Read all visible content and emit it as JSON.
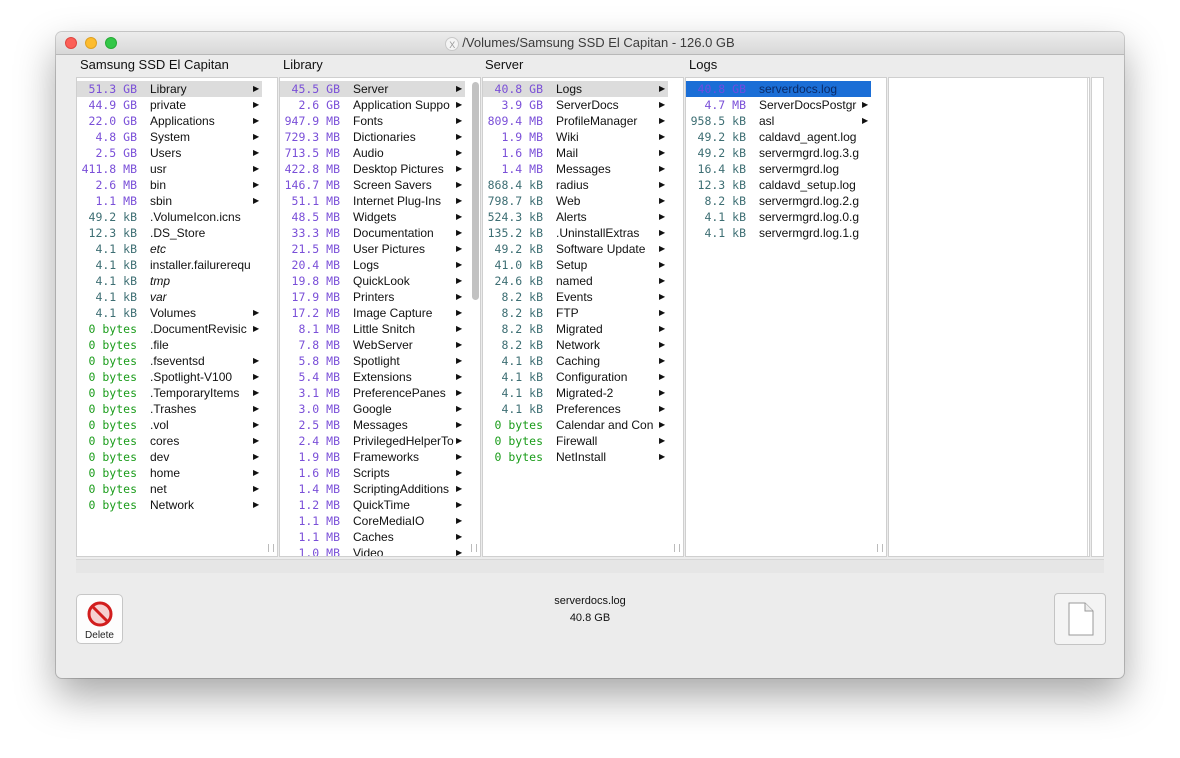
{
  "window": {
    "title": "/Volumes/Samsung SSD El Capitan  - 126.0 GB",
    "title_icon_glyph": "X"
  },
  "columns": [
    {
      "header": "Samsung SSD El Capitan",
      "selected_index": 0,
      "rows": [
        {
          "size": "51.3 GB",
          "name": "Library",
          "unit": "gb",
          "arrow": true
        },
        {
          "size": "44.9 GB",
          "name": "private",
          "unit": "gb",
          "arrow": true
        },
        {
          "size": "22.0 GB",
          "name": "Applications",
          "unit": "gb",
          "arrow": true
        },
        {
          "size": "4.8 GB",
          "name": "System",
          "unit": "gb",
          "arrow": true
        },
        {
          "size": "2.5 GB",
          "name": "Users",
          "unit": "gb",
          "arrow": true
        },
        {
          "size": "411.8 MB",
          "name": "usr",
          "unit": "mb",
          "arrow": true
        },
        {
          "size": "2.6 MB",
          "name": "bin",
          "unit": "mb",
          "arrow": true
        },
        {
          "size": "1.1 MB",
          "name": "sbin",
          "unit": "mb",
          "arrow": true
        },
        {
          "size": "49.2 kB",
          "name": ".VolumeIcon.icns",
          "unit": "kb",
          "arrow": false
        },
        {
          "size": "12.3 kB",
          "name": ".DS_Store",
          "unit": "kb",
          "arrow": false
        },
        {
          "size": "4.1 kB",
          "name": "etc",
          "unit": "kb",
          "arrow": false,
          "italic": true
        },
        {
          "size": "4.1 kB",
          "name": "installer.failurerequ",
          "unit": "kb",
          "arrow": false
        },
        {
          "size": "4.1 kB",
          "name": "tmp",
          "unit": "kb",
          "arrow": false,
          "italic": true
        },
        {
          "size": "4.1 kB",
          "name": "var",
          "unit": "kb",
          "arrow": false,
          "italic": true
        },
        {
          "size": "4.1 kB",
          "name": "Volumes",
          "unit": "kb",
          "arrow": true
        },
        {
          "size": "0 bytes",
          "name": ".DocumentRevisic",
          "unit": "zero",
          "arrow": true
        },
        {
          "size": "0 bytes",
          "name": ".file",
          "unit": "zero",
          "arrow": false
        },
        {
          "size": "0 bytes",
          "name": ".fseventsd",
          "unit": "zero",
          "arrow": true
        },
        {
          "size": "0 bytes",
          "name": ".Spotlight-V100",
          "unit": "zero",
          "arrow": true
        },
        {
          "size": "0 bytes",
          "name": ".TemporaryItems",
          "unit": "zero",
          "arrow": true
        },
        {
          "size": "0 bytes",
          "name": ".Trashes",
          "unit": "zero",
          "arrow": true
        },
        {
          "size": "0 bytes",
          "name": ".vol",
          "unit": "zero",
          "arrow": true
        },
        {
          "size": "0 bytes",
          "name": "cores",
          "unit": "zero",
          "arrow": true
        },
        {
          "size": "0 bytes",
          "name": "dev",
          "unit": "zero",
          "arrow": true
        },
        {
          "size": "0 bytes",
          "name": "home",
          "unit": "zero",
          "arrow": true
        },
        {
          "size": "0 bytes",
          "name": "net",
          "unit": "zero",
          "arrow": true
        },
        {
          "size": "0 bytes",
          "name": "Network",
          "unit": "zero",
          "arrow": true
        }
      ]
    },
    {
      "header": "Library",
      "selected_index": 0,
      "scrollbar": true,
      "rows": [
        {
          "size": "45.5 GB",
          "name": "Server",
          "unit": "gb",
          "arrow": true
        },
        {
          "size": "2.6 GB",
          "name": "Application Suppo",
          "unit": "gb",
          "arrow": true
        },
        {
          "size": "947.9 MB",
          "name": "Fonts",
          "unit": "mb",
          "arrow": true
        },
        {
          "size": "729.3 MB",
          "name": "Dictionaries",
          "unit": "mb",
          "arrow": true
        },
        {
          "size": "713.5 MB",
          "name": "Audio",
          "unit": "mb",
          "arrow": true
        },
        {
          "size": "422.8 MB",
          "name": "Desktop Pictures",
          "unit": "mb",
          "arrow": true
        },
        {
          "size": "146.7 MB",
          "name": "Screen Savers",
          "unit": "mb",
          "arrow": true
        },
        {
          "size": "51.1 MB",
          "name": "Internet Plug-Ins",
          "unit": "mb",
          "arrow": true
        },
        {
          "size": "48.5 MB",
          "name": "Widgets",
          "unit": "mb",
          "arrow": true
        },
        {
          "size": "33.3 MB",
          "name": "Documentation",
          "unit": "mb",
          "arrow": true
        },
        {
          "size": "21.5 MB",
          "name": "User Pictures",
          "unit": "mb",
          "arrow": true
        },
        {
          "size": "20.4 MB",
          "name": "Logs",
          "unit": "mb",
          "arrow": true
        },
        {
          "size": "19.8 MB",
          "name": "QuickLook",
          "unit": "mb",
          "arrow": true
        },
        {
          "size": "17.9 MB",
          "name": "Printers",
          "unit": "mb",
          "arrow": true
        },
        {
          "size": "17.2 MB",
          "name": "Image Capture",
          "unit": "mb",
          "arrow": true
        },
        {
          "size": "8.1 MB",
          "name": "Little Snitch",
          "unit": "mb",
          "arrow": true
        },
        {
          "size": "7.8 MB",
          "name": "WebServer",
          "unit": "mb",
          "arrow": true
        },
        {
          "size": "5.8 MB",
          "name": "Spotlight",
          "unit": "mb",
          "arrow": true
        },
        {
          "size": "5.4 MB",
          "name": "Extensions",
          "unit": "mb",
          "arrow": true
        },
        {
          "size": "3.1 MB",
          "name": "PreferencePanes",
          "unit": "mb",
          "arrow": true
        },
        {
          "size": "3.0 MB",
          "name": "Google",
          "unit": "mb",
          "arrow": true
        },
        {
          "size": "2.5 MB",
          "name": "Messages",
          "unit": "mb",
          "arrow": true
        },
        {
          "size": "2.4 MB",
          "name": "PrivilegedHelperTo",
          "unit": "mb",
          "arrow": true
        },
        {
          "size": "1.9 MB",
          "name": "Frameworks",
          "unit": "mb",
          "arrow": true
        },
        {
          "size": "1.6 MB",
          "name": "Scripts",
          "unit": "mb",
          "arrow": true
        },
        {
          "size": "1.4 MB",
          "name": "ScriptingAdditions",
          "unit": "mb",
          "arrow": true
        },
        {
          "size": "1.2 MB",
          "name": "QuickTime",
          "unit": "mb",
          "arrow": true
        },
        {
          "size": "1.1 MB",
          "name": "CoreMediaIO",
          "unit": "mb",
          "arrow": true
        },
        {
          "size": "1.1 MB",
          "name": "Caches",
          "unit": "mb",
          "arrow": true
        },
        {
          "size": "1.0 MB",
          "name": "Video",
          "unit": "mb",
          "arrow": true
        }
      ]
    },
    {
      "header": "Server",
      "selected_index": 0,
      "rows": [
        {
          "size": "40.8 GB",
          "name": "Logs",
          "unit": "gb",
          "arrow": true
        },
        {
          "size": "3.9 GB",
          "name": "ServerDocs",
          "unit": "gb",
          "arrow": true
        },
        {
          "size": "809.4 MB",
          "name": "ProfileManager",
          "unit": "mb",
          "arrow": true
        },
        {
          "size": "1.9 MB",
          "name": "Wiki",
          "unit": "mb",
          "arrow": true
        },
        {
          "size": "1.6 MB",
          "name": "Mail",
          "unit": "mb",
          "arrow": true
        },
        {
          "size": "1.4 MB",
          "name": "Messages",
          "unit": "mb",
          "arrow": true
        },
        {
          "size": "868.4 kB",
          "name": "radius",
          "unit": "kb",
          "arrow": true
        },
        {
          "size": "798.7 kB",
          "name": "Web",
          "unit": "kb",
          "arrow": true
        },
        {
          "size": "524.3 kB",
          "name": "Alerts",
          "unit": "kb",
          "arrow": true
        },
        {
          "size": "135.2 kB",
          "name": ".UninstallExtras",
          "unit": "kb",
          "arrow": true
        },
        {
          "size": "49.2 kB",
          "name": "Software Update",
          "unit": "kb",
          "arrow": true
        },
        {
          "size": "41.0 kB",
          "name": "Setup",
          "unit": "kb",
          "arrow": true
        },
        {
          "size": "24.6 kB",
          "name": "named",
          "unit": "kb",
          "arrow": true
        },
        {
          "size": "8.2 kB",
          "name": "Events",
          "unit": "kb",
          "arrow": true
        },
        {
          "size": "8.2 kB",
          "name": "FTP",
          "unit": "kb",
          "arrow": true
        },
        {
          "size": "8.2 kB",
          "name": "Migrated",
          "unit": "kb",
          "arrow": true
        },
        {
          "size": "8.2 kB",
          "name": "Network",
          "unit": "kb",
          "arrow": true
        },
        {
          "size": "4.1 kB",
          "name": "Caching",
          "unit": "kb",
          "arrow": true
        },
        {
          "size": "4.1 kB",
          "name": "Configuration",
          "unit": "kb",
          "arrow": true
        },
        {
          "size": "4.1 kB",
          "name": "Migrated-2",
          "unit": "kb",
          "arrow": true
        },
        {
          "size": "4.1 kB",
          "name": "Preferences",
          "unit": "kb",
          "arrow": true
        },
        {
          "size": "0 bytes",
          "name": "Calendar and Con",
          "unit": "zero",
          "arrow": true
        },
        {
          "size": "0 bytes",
          "name": "Firewall",
          "unit": "zero",
          "arrow": true
        },
        {
          "size": "0 bytes",
          "name": "NetInstall",
          "unit": "zero",
          "arrow": true
        }
      ]
    },
    {
      "header": "Logs",
      "selected_index": 0,
      "active": true,
      "rows": [
        {
          "size": "40.8 GB",
          "name": "serverdocs.log",
          "unit": "gb",
          "arrow": false
        },
        {
          "size": "4.7 MB",
          "name": "ServerDocsPostgr",
          "unit": "mb",
          "arrow": true
        },
        {
          "size": "958.5 kB",
          "name": "asl",
          "unit": "kb",
          "arrow": true
        },
        {
          "size": "49.2 kB",
          "name": "caldavd_agent.log",
          "unit": "kb",
          "arrow": false
        },
        {
          "size": "49.2 kB",
          "name": "servermgrd.log.3.g",
          "unit": "kb",
          "arrow": false
        },
        {
          "size": "16.4 kB",
          "name": "servermgrd.log",
          "unit": "kb",
          "arrow": false
        },
        {
          "size": "12.3 kB",
          "name": "caldavd_setup.log",
          "unit": "kb",
          "arrow": false
        },
        {
          "size": "8.2 kB",
          "name": "servermgrd.log.2.g",
          "unit": "kb",
          "arrow": false
        },
        {
          "size": "4.1 kB",
          "name": "servermgrd.log.0.g",
          "unit": "kb",
          "arrow": false
        },
        {
          "size": "4.1 kB",
          "name": "servermgrd.log.1.g",
          "unit": "kb",
          "arrow": false
        }
      ]
    }
  ],
  "footer": {
    "delete_label": "Delete",
    "delete_icon": "no-entry-icon",
    "selected_name": "serverdocs.log",
    "selected_size": "40.8 GB",
    "preview_icon": "document-icon"
  }
}
